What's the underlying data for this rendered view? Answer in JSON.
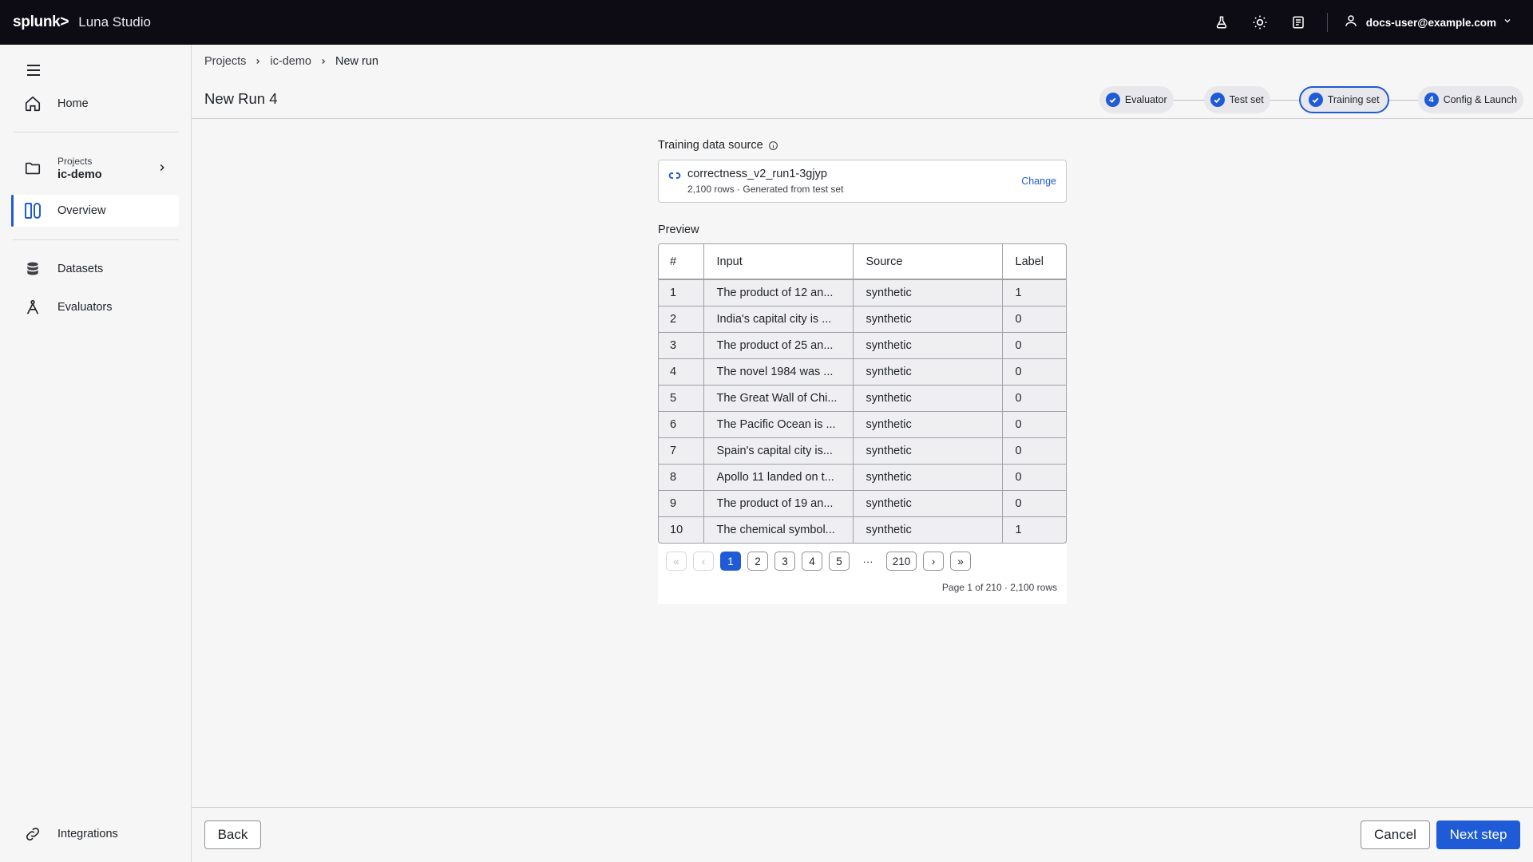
{
  "app": {
    "logo": "splunk>",
    "name": "Luna Studio"
  },
  "topbar": {
    "user_email": "docs-user@example.com",
    "icons": [
      "flask-icon",
      "sun-icon",
      "book-icon",
      "user-icon"
    ]
  },
  "sidebar": {
    "home_label": "Home",
    "project_caption": "Projects",
    "project_name": "ic-demo",
    "overview_label": "Overview",
    "datasets_label": "Datasets",
    "evaluators_label": "Evaluators",
    "integrations_label": "Integrations"
  },
  "breadcrumb": {
    "items": [
      "Projects",
      "ic-demo",
      "New run"
    ]
  },
  "page": {
    "title": "New Run 4"
  },
  "stepper": {
    "steps": [
      {
        "label": "Evaluator",
        "state": "done"
      },
      {
        "label": "Test set",
        "state": "done"
      },
      {
        "label": "Training set",
        "state": "current"
      },
      {
        "label": "Config & Launch",
        "state": "pending",
        "number": "4"
      }
    ]
  },
  "training_source": {
    "label": "Training data source",
    "dataset_name": "correctness_v2_run1-3gjyp",
    "meta": "2,100 rows · Generated from test set",
    "change_label": "Change"
  },
  "preview": {
    "label": "Preview",
    "columns": [
      "#",
      "Input",
      "Source",
      "Label"
    ],
    "rows": [
      [
        "1",
        "The product of 12 an...",
        "synthetic",
        "1"
      ],
      [
        "2",
        "India's capital city is ...",
        "synthetic",
        "0"
      ],
      [
        "3",
        "The product of 25 an...",
        "synthetic",
        "0"
      ],
      [
        "4",
        "The novel 1984 was ...",
        "synthetic",
        "0"
      ],
      [
        "5",
        "The Great Wall of Chi...",
        "synthetic",
        "0"
      ],
      [
        "6",
        "The Pacific Ocean is ...",
        "synthetic",
        "0"
      ],
      [
        "7",
        "Spain's capital city is...",
        "synthetic",
        "0"
      ],
      [
        "8",
        "Apollo 11 landed on t...",
        "synthetic",
        "0"
      ],
      [
        "9",
        "The product of 19 an...",
        "synthetic",
        "0"
      ],
      [
        "10",
        "The chemical symbol...",
        "synthetic",
        "1"
      ]
    ],
    "pagination": {
      "first": "«",
      "prev": "‹",
      "pages": [
        "1",
        "2",
        "3",
        "4",
        "5"
      ],
      "ellipsis": "···",
      "last_page": "210",
      "next": "›",
      "last": "»",
      "current_page": "1",
      "summary": "Page 1 of 210 · 2,100 rows"
    }
  },
  "footer": {
    "back_label": "Back",
    "cancel_label": "Cancel",
    "next_label": "Next step"
  },
  "colors": {
    "accent": "#1f5bd6",
    "topbar": "#0d0c14",
    "background": "#f6f6f6"
  }
}
